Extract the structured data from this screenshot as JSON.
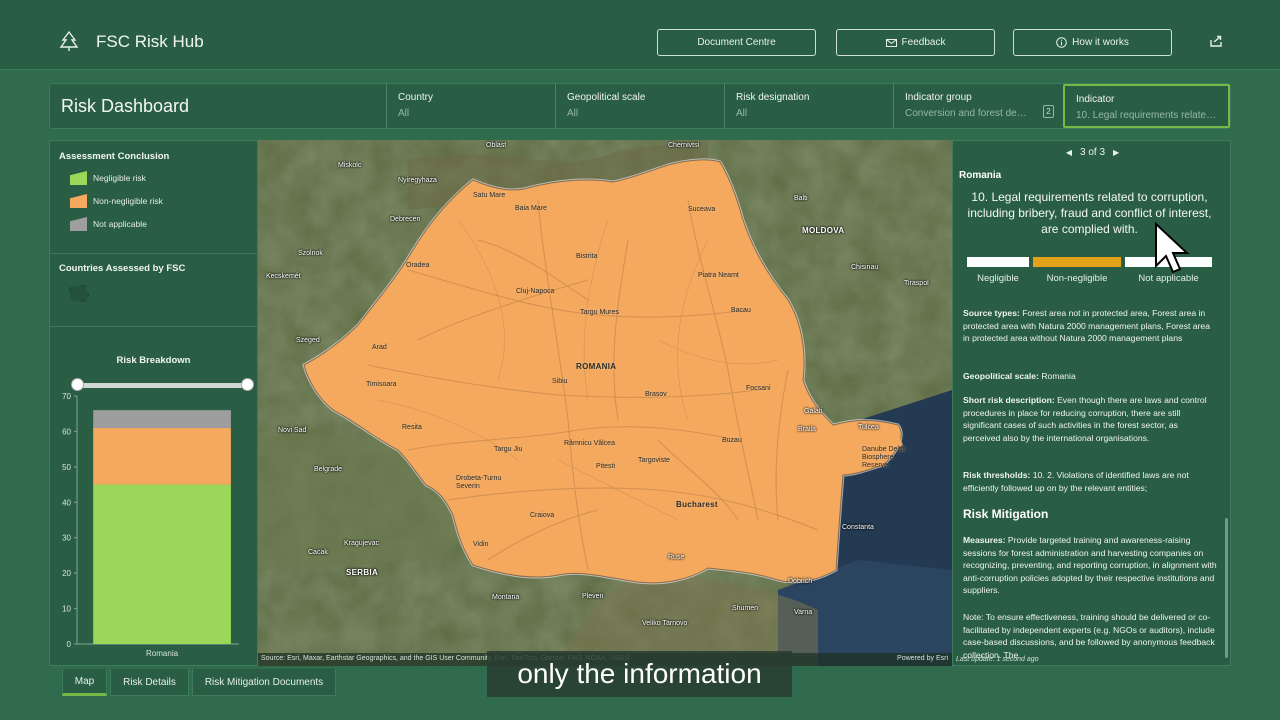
{
  "header": {
    "app_title": "FSC Risk Hub",
    "buttons": [
      {
        "label": "Document Centre",
        "icon": "none"
      },
      {
        "label": "Feedback",
        "icon": "mail-icon"
      },
      {
        "label": "How it works",
        "icon": "info-icon"
      }
    ],
    "share_icon": "share-icon"
  },
  "filters": {
    "dashboard_title": "Risk Dashboard",
    "items": [
      {
        "label": "Country",
        "value": "All"
      },
      {
        "label": "Geopolitical scale",
        "value": "All"
      },
      {
        "label": "Risk designation",
        "value": "All"
      },
      {
        "label": "Indicator group",
        "value": "Conversion and forest deg…",
        "count": "2"
      },
      {
        "label": "Indicator",
        "value": "10. Legal requirements related…"
      }
    ]
  },
  "left": {
    "assessment_title": "Assessment Conclusion",
    "legend": [
      {
        "label": "Negligible risk",
        "color": "#9bd85a"
      },
      {
        "label": "Non-negligible risk",
        "color": "#f4a95f"
      },
      {
        "label": "Not applicable",
        "color": "#9e9e9e"
      }
    ],
    "countries_title": "Countries Assessed by FSC",
    "breakdown_title": "Risk Breakdown"
  },
  "chart_data": {
    "type": "bar",
    "stacked": true,
    "categories": [
      "Romania"
    ],
    "series": [
      {
        "name": "Negligible risk",
        "values": [
          45
        ],
        "color": "#9bd85a"
      },
      {
        "name": "Non-negligible risk",
        "values": [
          16
        ],
        "color": "#f4a95f"
      },
      {
        "name": "Not applicable",
        "values": [
          5
        ],
        "color": "#9e9e9e"
      }
    ],
    "yticks": [
      0,
      10,
      20,
      30,
      40,
      50,
      60,
      70
    ],
    "ylim": [
      0,
      70
    ]
  },
  "map": {
    "places": [
      "Oblast",
      "Chernivtsi",
      "Miskolc",
      "Nyiregyhaza",
      "Satu Mare",
      "Baia Mare",
      "Suceava",
      "Balti",
      "Debrecen",
      "MOLDOVA",
      "Szolnok",
      "Oradea",
      "Bistrita",
      "Kecskemét",
      "Piatra Neamt",
      "Chisinau",
      "Cluj-Napoca",
      "Targu Mures",
      "Bacau",
      "Tiraspol",
      "Szeged",
      "Arad",
      "ROMANIA",
      "Timisoara",
      "Sibiu",
      "Brasov",
      "Focsani",
      "Galati",
      "Resita",
      "Braila",
      "Tulcea",
      "Novi Sad",
      "Targu Jiu",
      "Râmnicu Vâlcea",
      "Buzau",
      "Danube Delta Biosphere Reserve",
      "Belgrade",
      "Drobeta-Turnu Severin",
      "Pitesti",
      "Targoviste",
      "Craiova",
      "Bucharest",
      "Constanta",
      "Kragujevac",
      "Vidin",
      "Ruse",
      "Cacak",
      "SERBIA",
      "Montana",
      "Pleven",
      "Dobrich",
      "Shumen",
      "Varna",
      "Veliko Tarnovo"
    ],
    "attribution": "Source: Esri, Maxar, Earthstar Geographics, and the GIS User Community, Esri, TomTom, Garmin, FAO, NOAA, USGS",
    "powered_by": "Powered by Esri"
  },
  "details": {
    "pager": "3 of 3",
    "country": "Romania",
    "indicator_title": "10. Legal requirements related to corruption, including bribery, fraud and conflict of interest, are complied with.",
    "designation_labels": [
      "Negligible",
      "Non-negligible",
      "Not applicable"
    ],
    "source_types_label": "Source types:",
    "source_types": "Forest area not in protected area, Forest area in protected area with Natura 2000 management plans, Forest area in protected area without Natura 2000 management plans",
    "geo_label": "Geopolitical scale:",
    "geo_value": "Romania",
    "short_label": "Short risk description:",
    "short_value": "Even though there are laws and control procedures in place for reducing corruption, there are still significant cases of such activities in the forest sector, as perceived also by the international organisations.",
    "thresholds_label": "Risk thresholds:",
    "thresholds_value": "10. 2. Violations of identified laws are not efficiently followed up on by the relevant entities;",
    "mitigation_heading": "Risk Mitigation",
    "measures_label": "Measures:",
    "measures_value": "Provide targeted training and awareness-raising sessions for forest administration and harvesting companies on recognizing, preventing, and reporting corruption, in alignment with anti-corruption policies adopted by their respective institutions and suppliers.",
    "note": "Note: To ensure effectiveness, training should be delivered or co-facilitated by independent experts (e.g. NGOs or auditors), include case-based discussions, and be followed by anonymous feedback collection. The",
    "last_update": "Last update: 1 second ago"
  },
  "tabs": [
    "Map",
    "Risk Details",
    "Risk Mitigation Documents"
  ],
  "caption": "only the information"
}
